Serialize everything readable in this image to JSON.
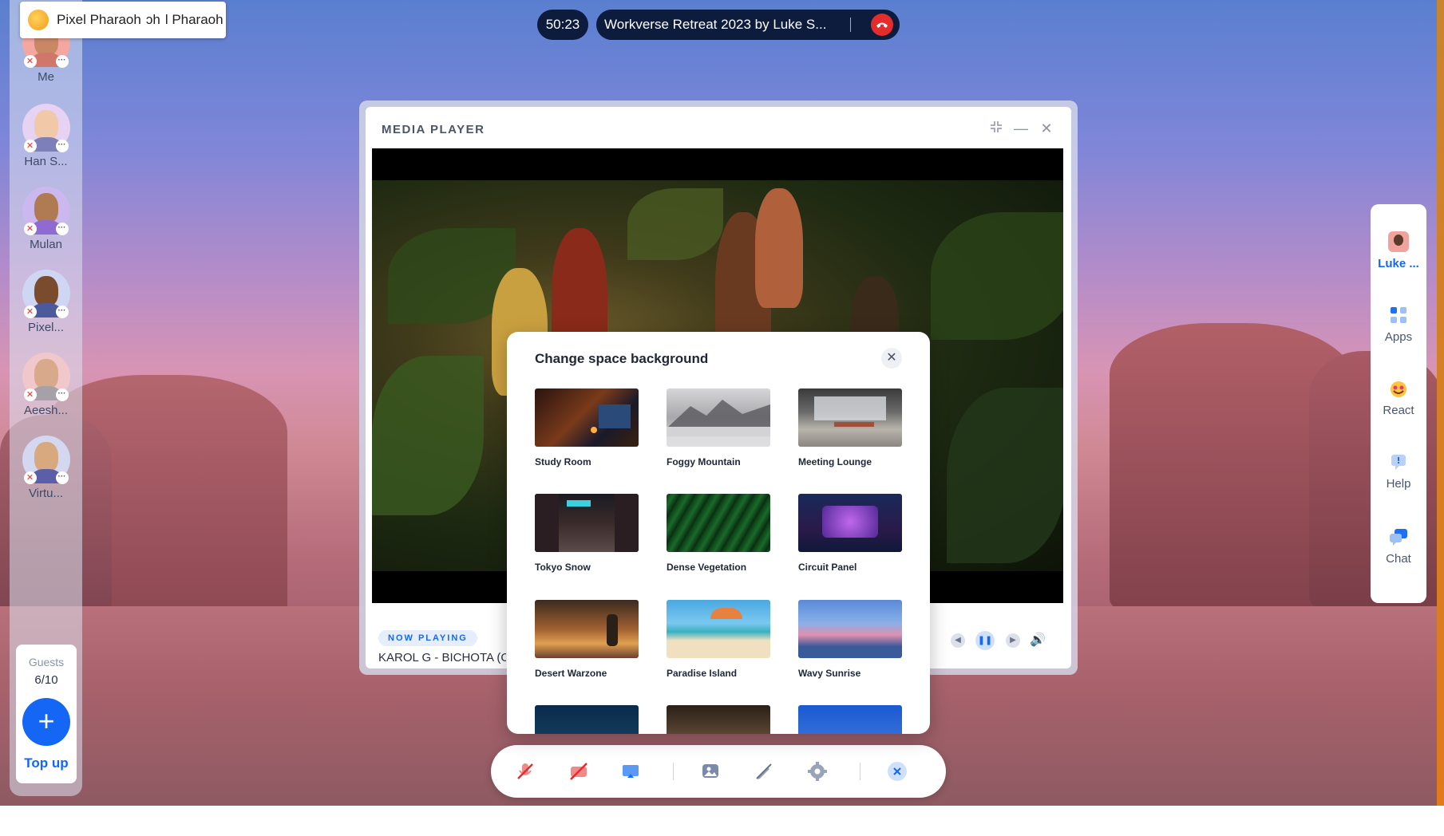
{
  "call": {
    "timer": "50:23",
    "title": "Workverse Retreat 2023 by Luke S...",
    "hangup_icon": "phone-hangup-icon"
  },
  "tooltip": {
    "name": "Pixel Pharaoh",
    "trailing": "ɔh",
    "trailing2": "l Pharaoh"
  },
  "members": [
    {
      "name": "Me",
      "colors": {
        "bg": "#f3a7a0",
        "face": "#c98764",
        "body": "#d0766a"
      }
    },
    {
      "name": "Han S...",
      "colors": {
        "bg": "#e6d2f3",
        "face": "#f2c9a8",
        "body": "#7d7fb8"
      }
    },
    {
      "name": "Mulan",
      "colors": {
        "bg": "#cbb8ee",
        "face": "#b07a52",
        "body": "#8f6ad0"
      }
    },
    {
      "name": "Pixel...",
      "colors": {
        "bg": "#cfd6f3",
        "face": "#7a4b2c",
        "body": "#4a5a9a"
      }
    },
    {
      "name": "Aeesh...",
      "colors": {
        "bg": "#f0c8cc",
        "face": "#d8a98a",
        "body": "#a6a0a8"
      }
    },
    {
      "name": "Virtu...",
      "colors": {
        "bg": "#d3d7f0",
        "face": "#d8a97e",
        "body": "#5a5fa8"
      }
    }
  ],
  "guests": {
    "label": "Guests",
    "count": "6/10",
    "topup_symbol": "+",
    "topup_label": "Top up"
  },
  "right_sidebar": [
    {
      "label": "Luke ...",
      "icon": "luke-avatar-icon",
      "active": true
    },
    {
      "label": "Apps",
      "icon": "apps-grid-icon",
      "active": false
    },
    {
      "label": "React",
      "icon": "react-emoji-icon",
      "active": false
    },
    {
      "label": "Help",
      "icon": "help-chat-icon",
      "active": false
    },
    {
      "label": "Chat",
      "icon": "chat-bubble-icon",
      "active": false
    }
  ],
  "media_player": {
    "title": "MEDIA PLAYER",
    "now_playing_tag": "NOW PLAYING",
    "track": "KAROL G - BICHOTA (Of"
  },
  "modal": {
    "title": "Change space background",
    "options": [
      {
        "label": "Study Room"
      },
      {
        "label": "Foggy Mountain"
      },
      {
        "label": "Meeting Lounge"
      },
      {
        "label": "Tokyo Snow"
      },
      {
        "label": "Dense Vegetation"
      },
      {
        "label": "Circuit Panel"
      },
      {
        "label": "Desert Warzone"
      },
      {
        "label": "Paradise Island"
      },
      {
        "label": "Wavy Sunrise"
      }
    ]
  },
  "toolbar": {
    "items": [
      "mic-off-icon",
      "camera-off-icon",
      "screen-share-icon",
      "background-image-icon",
      "pen-off-icon",
      "settings-gear-icon",
      "close-icon"
    ]
  },
  "colors": {
    "accent": "#1467f5",
    "danger": "#e52c2c",
    "pill_bg": "#0d1b3d"
  }
}
